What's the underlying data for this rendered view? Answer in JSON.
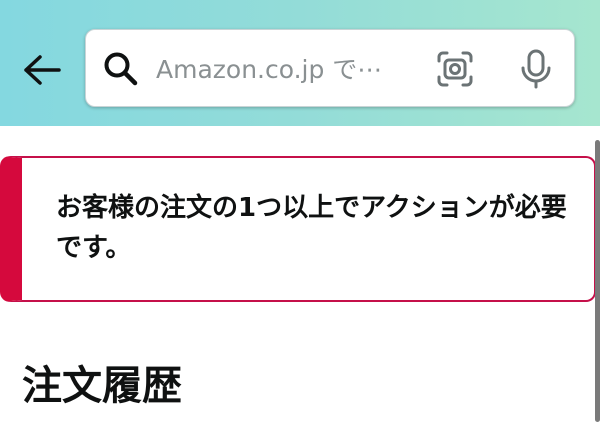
{
  "header": {
    "back_icon": "arrow-left-icon",
    "search": {
      "placeholder": "Amazon.co.jp で⋯",
      "value": "",
      "search_icon": "search-icon",
      "camera_icon": "camera-scan-icon",
      "mic_icon": "microphone-icon"
    }
  },
  "alert": {
    "message": "お客様の注文の1つ以上でアクションが必要です。",
    "accent_color": "#d5093d"
  },
  "main": {
    "title": "注文履歴"
  }
}
